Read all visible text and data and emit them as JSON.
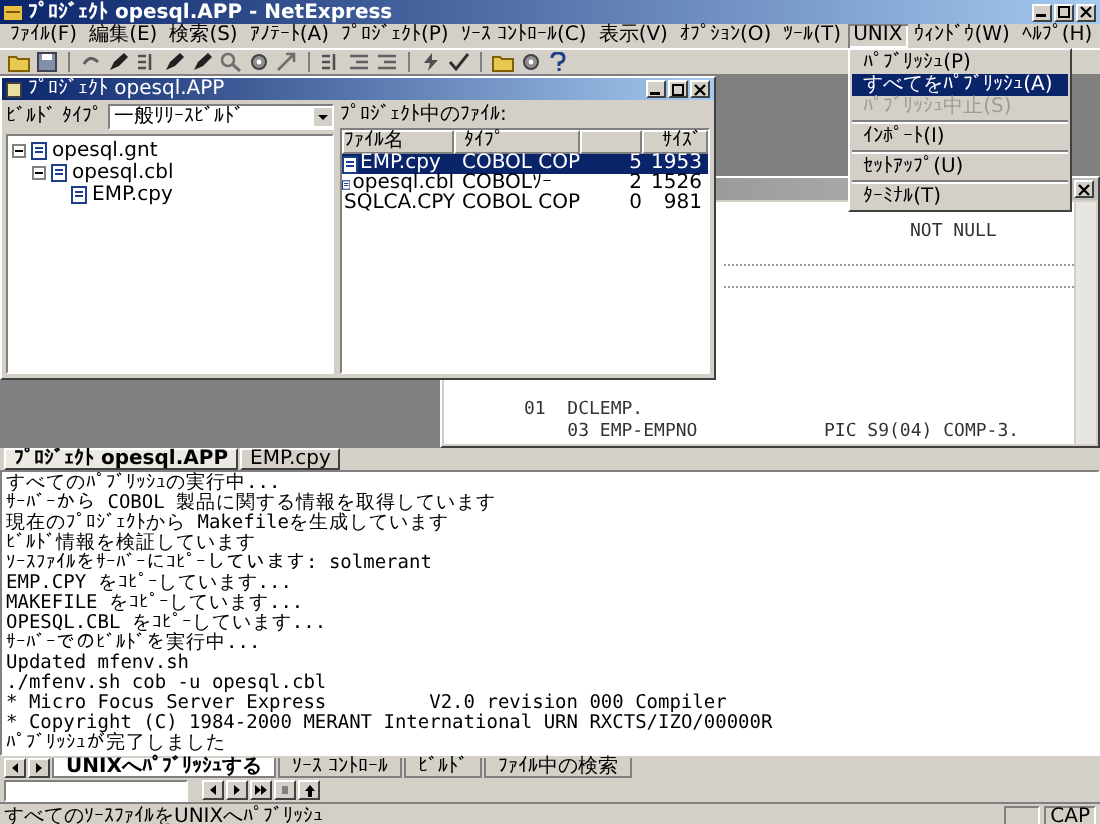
{
  "window": {
    "title": "ﾌﾟﾛｼﾞｪｸﾄ opesql.APP - NetExpress"
  },
  "menu_bar": [
    {
      "label": "ﾌｧｲﾙ(F)",
      "selected": false
    },
    {
      "label": "編集(E)",
      "selected": false
    },
    {
      "label": "検索(S)",
      "selected": false
    },
    {
      "label": "ｱﾉﾃｰﾄ(A)",
      "selected": false
    },
    {
      "label": "ﾌﾟﾛｼﾞｪｸﾄ(P)",
      "selected": false
    },
    {
      "label": "ｿｰｽ ｺﾝﾄﾛｰﾙ(C)",
      "selected": false
    },
    {
      "label": "表示(V)",
      "selected": false
    },
    {
      "label": "ｵﾌﾟｼｮﾝ(O)",
      "selected": false
    },
    {
      "label": "ﾂｰﾙ(T)",
      "selected": false
    },
    {
      "label": "UNIX",
      "selected": true
    },
    {
      "label": "ｳｨﾝﾄﾞｳ(W)",
      "selected": false
    },
    {
      "label": "ﾍﾙﾌﾟ(H)",
      "selected": false
    }
  ],
  "unix_menu": [
    {
      "kind": "item",
      "label": "ﾊﾟﾌﾞﾘｯｼｭ(P)",
      "selected": false,
      "disabled": false
    },
    {
      "kind": "item",
      "label": "すべてをﾊﾟﾌﾞﾘｯｼｭ(A)",
      "selected": true,
      "disabled": false
    },
    {
      "kind": "item",
      "label": "ﾊﾟﾌﾞﾘｯｼｭ中止(S)",
      "selected": false,
      "disabled": true
    },
    {
      "kind": "separator"
    },
    {
      "kind": "item",
      "label": "ｲﾝﾎﾟｰﾄ(I)",
      "selected": false,
      "disabled": false
    },
    {
      "kind": "separator"
    },
    {
      "kind": "item",
      "label": "ｾｯﾄｱｯﾌﾟ(U)",
      "selected": false,
      "disabled": false
    },
    {
      "kind": "separator"
    },
    {
      "kind": "item",
      "label": "ﾀｰﾐﾅﾙ(T)",
      "selected": false,
      "disabled": false
    }
  ],
  "project_window": {
    "title": "ﾌﾟﾛｼﾞｪｸﾄ opesql.APP",
    "build_type_label": "ﾋﾞﾙﾄﾞ ﾀｲﾌﾟ",
    "build_type": "一般ﾘﾘｰｽﾋﾞﾙﾄﾞ",
    "tree": [
      {
        "label": "opesql.gnt",
        "expanded": true,
        "children": [
          {
            "label": "opesql.cbl",
            "expanded": true,
            "children": [
              {
                "label": "EMP.cpy"
              }
            ]
          }
        ]
      }
    ],
    "files_label": "ﾌﾟﾛｼﾞｪｸﾄ中のﾌｧｲﾙ:",
    "columns": [
      {
        "label": "ﾌｧｲﾙ名"
      },
      {
        "label": "ﾀｲﾌﾟ"
      },
      {
        "label": "ｻｲｽﾞ"
      }
    ],
    "rows": [
      {
        "name": "EMP.cpy",
        "type": "COBOL COP",
        "column_3": "5",
        "size": "1953",
        "selected": true
      },
      {
        "name": "opesql.cbl",
        "type": "COBOLｿｰ",
        "column_3": "2",
        "size": "1526",
        "selected": false
      },
      {
        "name": "SQLCA.CPY",
        "type": "COBOL COP",
        "column_3": "0",
        "size": "981",
        "selected": false
      }
    ]
  },
  "editor_window": {
    "top_text": "NOT NULL",
    "code_lines": [
      {
        "name": "01  DCLEMP."
      },
      {
        "name": "    03 EMP-EMPNO",
        "clause": "PIC S9(04) COMP-3."
      }
    ]
  },
  "document_tabs": [
    {
      "label": "ﾌﾟﾛｼﾞｪｸﾄ opesql.APP",
      "selected": true
    },
    {
      "label": "EMP.cpy",
      "selected": false
    }
  ],
  "output": {
    "lines": [
      "すべてのﾊﾟﾌﾞﾘｯｼｭの実行中...",
      "ｻｰﾊﾞｰから COBOL 製品に関する情報を取得しています",
      "現在のﾌﾟﾛｼﾞｪｸﾄから Makefileを生成しています",
      "ﾋﾞﾙﾄﾞ情報を検証しています",
      "ｿｰｽﾌｧｲﾙをｻｰﾊﾞｰにｺﾋﾟｰしています: solmerant",
      "EMP.CPY をｺﾋﾟｰしています...",
      "MAKEFILE をｺﾋﾟｰしています...",
      "OPESQL.CBL をｺﾋﾟｰしています...",
      "ｻｰﾊﾞｰでのﾋﾞﾙﾄﾞを実行中...",
      "Updated mfenv.sh",
      "./mfenv.sh cob -u opesql.cbl",
      "* Micro Focus Server Express         V2.0 revision 000 Compiler",
      "* Copyright (C) 1984-2000 MERANT International URN RXCTS/IZO/00000R",
      "ﾊﾟﾌﾞﾘｯｼｭが完了しました"
    ]
  },
  "output_tabs": [
    {
      "label": "UNIXへﾊﾟﾌﾞﾘｯｼｭする",
      "selected": true
    },
    {
      "label": "ｿｰｽ ｺﾝﾄﾛｰﾙ",
      "selected": false
    },
    {
      "label": "ﾋﾞﾙﾄﾞ",
      "selected": false
    },
    {
      "label": "ﾌｧｲﾙ中の検索",
      "selected": false
    }
  ],
  "status_bar": {
    "text": "すべてのｿｰｽﾌｧｲﾙをUNIXへﾊﾟﾌﾞﾘｯｼｭ",
    "indicator": "CAP"
  }
}
